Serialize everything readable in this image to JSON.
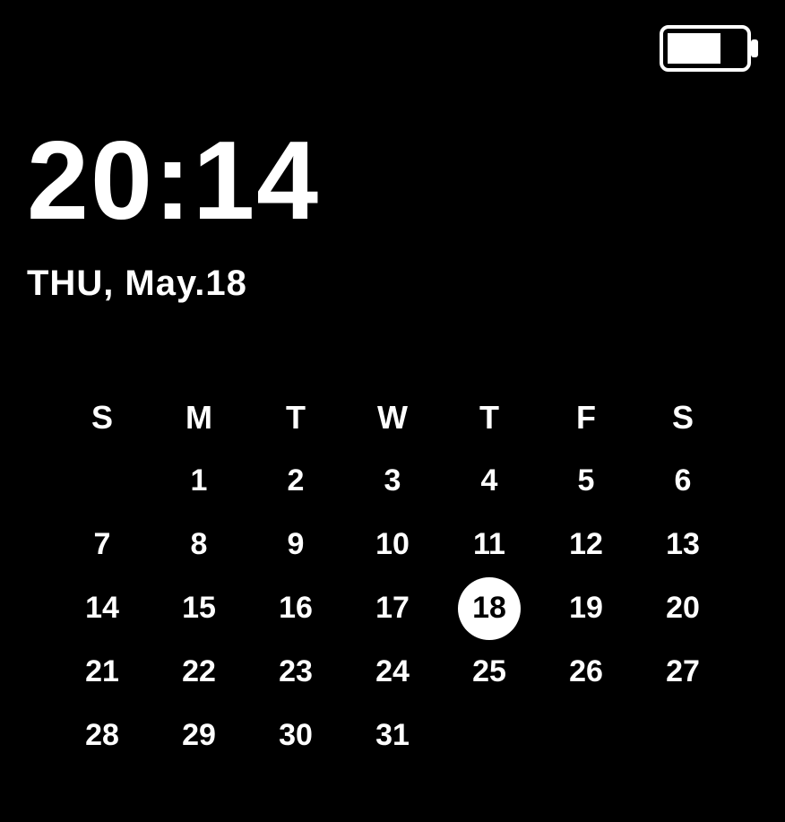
{
  "battery": {
    "level_pct": 70
  },
  "clock": {
    "time": "20:14",
    "date": "THU, May.18"
  },
  "calendar": {
    "weekdays": [
      "S",
      "M",
      "T",
      "W",
      "T",
      "F",
      "S"
    ],
    "selected_day": 18,
    "weeks": [
      [
        "",
        "1",
        "2",
        "3",
        "4",
        "5",
        "6"
      ],
      [
        "7",
        "8",
        "9",
        "10",
        "11",
        "12",
        "13"
      ],
      [
        "14",
        "15",
        "16",
        "17",
        "18",
        "19",
        "20"
      ],
      [
        "21",
        "22",
        "23",
        "24",
        "25",
        "26",
        "27"
      ],
      [
        "28",
        "29",
        "30",
        "31",
        "",
        "",
        ""
      ]
    ]
  }
}
